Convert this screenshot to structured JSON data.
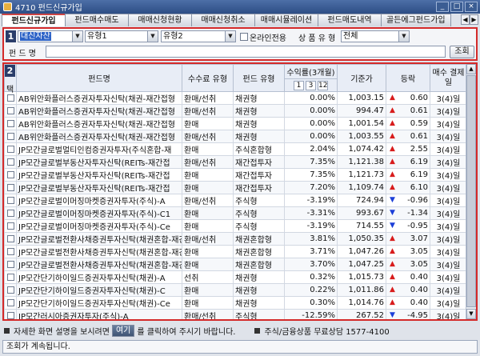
{
  "window": {
    "title": "4710 펀드신규가입"
  },
  "tabs": [
    "펀드신규가입",
    "펀드매수매도",
    "매매신청현황",
    "매매신청취소",
    "매매시뮬레이션",
    "펀드매도내역",
    "골든에그펀드가입"
  ],
  "filter": {
    "section_num": "1",
    "company": "대신자산",
    "type1": "유형1",
    "type2": "유형2",
    "online_only_label": "온라인전용",
    "product_type_label": "상 품 유 형",
    "product_type_value": "전체",
    "fund_name_label": "펀 드 명",
    "fund_name_value": "",
    "search_button": "조회"
  },
  "grid": {
    "section_num": "2",
    "headers": {
      "check": "택",
      "name": "펀드명",
      "fee_type": "수수료 유형",
      "fund_type": "펀드 유형",
      "return": "수익률(3개월)",
      "return_sub": [
        "1",
        "3",
        "12"
      ],
      "base_price": "기준가",
      "change": "등락",
      "buy_day": "매수 결제일"
    },
    "rows": [
      {
        "name": "AB위안화플러스증권자투자신탁(채권-재간접형",
        "fee": "환매/선취",
        "ftype": "채권형",
        "ret": "0.00%",
        "price": "1,003.15",
        "dir": "up",
        "chg": "0.60",
        "day": "3(4)일"
      },
      {
        "name": "AB위안화플러스증권자투자신탁(채권-재간접형",
        "fee": "환매/선취",
        "ftype": "채권형",
        "ret": "0.00%",
        "price": "994.47",
        "dir": "up",
        "chg": "0.61",
        "day": "3(4)일"
      },
      {
        "name": "AB위안화플러스증권자투자신탁(채권-재간접형",
        "fee": "환매",
        "ftype": "채권형",
        "ret": "0.00%",
        "price": "1,001.54",
        "dir": "up",
        "chg": "0.59",
        "day": "3(4)일"
      },
      {
        "name": "AB위안화플러스증권자투자신탁(채권-재간접형",
        "fee": "환매/선취",
        "ftype": "채권형",
        "ret": "0.00%",
        "price": "1,003.55",
        "dir": "up",
        "chg": "0.61",
        "day": "3(4)일"
      },
      {
        "name": "JP모간글로벌멀티인컴증권자투자(주식혼합-재",
        "fee": "환매",
        "ftype": "주식혼합형",
        "ret": "2.04%",
        "price": "1,074.42",
        "dir": "up",
        "chg": "2.55",
        "day": "3(4)일"
      },
      {
        "name": "JP모간글로벌부동산자투자신탁(REITs-재간접",
        "fee": "환매/선취",
        "ftype": "재간접투자",
        "ret": "7.35%",
        "price": "1,121.38",
        "dir": "up",
        "chg": "6.19",
        "day": "3(4)일"
      },
      {
        "name": "JP모간글로벌부동산자투자신탁(REITs-재간접",
        "fee": "환매",
        "ftype": "재간접투자",
        "ret": "7.35%",
        "price": "1,121.73",
        "dir": "up",
        "chg": "6.19",
        "day": "3(4)일"
      },
      {
        "name": "JP모간글로벌부동산자투자신탁(REITs-재간접",
        "fee": "환매",
        "ftype": "재간접투자",
        "ret": "7.20%",
        "price": "1,109.74",
        "dir": "up",
        "chg": "6.10",
        "day": "3(4)일"
      },
      {
        "name": "JP모간글로벌이머징마켓증권자투자(주식)-A",
        "fee": "환매/선취",
        "ftype": "주식형",
        "ret": "-3.19%",
        "price": "724.94",
        "dir": "dn",
        "chg": "-0.96",
        "day": "3(4)일"
      },
      {
        "name": "JP모간글로벌이머징마켓증권자투자(주식)-C1",
        "fee": "환매",
        "ftype": "주식형",
        "ret": "-3.31%",
        "price": "993.67",
        "dir": "dn",
        "chg": "-1.34",
        "day": "3(4)일"
      },
      {
        "name": "JP모간글로벌이머징마켓증권자투자(주식)-Ce",
        "fee": "환매",
        "ftype": "주식형",
        "ret": "-3.19%",
        "price": "714.55",
        "dir": "dn",
        "chg": "-0.95",
        "day": "3(4)일"
      },
      {
        "name": "JP모간글로벌전환사채증권투자신탁(채권혼합-재간",
        "fee": "환매/선취",
        "ftype": "채권혼합형",
        "ret": "3.81%",
        "price": "1,050.35",
        "dir": "up",
        "chg": "3.07",
        "day": "3(4)일"
      },
      {
        "name": "JP모간글로벌전환사채증권투자신탁(채권혼합-재간",
        "fee": "환매",
        "ftype": "채권혼합형",
        "ret": "3.71%",
        "price": "1,047.26",
        "dir": "up",
        "chg": "3.05",
        "day": "3(4)일"
      },
      {
        "name": "JP모간글로벌전환사채증권투자신탁(채권혼합-재간",
        "fee": "환매",
        "ftype": "채권혼합형",
        "ret": "3.70%",
        "price": "1,047.25",
        "dir": "up",
        "chg": "3.05",
        "day": "3(4)일"
      },
      {
        "name": "JP모간단기하이일드증권자투자신탁(채권)-A",
        "fee": "선취",
        "ftype": "채권형",
        "ret": "0.32%",
        "price": "1,015.73",
        "dir": "up",
        "chg": "0.40",
        "day": "3(4)일"
      },
      {
        "name": "JP모간단기하이일드증권자투자신탁(채권)-C",
        "fee": "환매",
        "ftype": "채권형",
        "ret": "0.22%",
        "price": "1,011.86",
        "dir": "up",
        "chg": "0.40",
        "day": "3(4)일"
      },
      {
        "name": "JP모간단기하이일드증권자투자신탁(채권)-Ce",
        "fee": "환매",
        "ftype": "채권형",
        "ret": "0.30%",
        "price": "1,014.76",
        "dir": "up",
        "chg": "0.40",
        "day": "3(4)일"
      },
      {
        "name": "JP모간러시아증권자투자(주식)-A",
        "fee": "환매/선취",
        "ftype": "주식형",
        "ret": "-12.59%",
        "price": "267.52",
        "dir": "dn",
        "chg": "-4.95",
        "day": "3(4)일"
      }
    ]
  },
  "footer": {
    "help_pre": "자세한 화면 설명을 보시려면",
    "help_btn": "여기",
    "help_post": "를 클릭하여 주시기 바랍니다.",
    "contact": "주식/금융상품 무료상담 1577-4100"
  },
  "status": {
    "text": "조회가 계속됩니다."
  },
  "colors": {
    "accent_red": "#d42a2a",
    "up": "#d81c1c",
    "down": "#1c3fd8",
    "title_blue": "#2d4e85"
  }
}
